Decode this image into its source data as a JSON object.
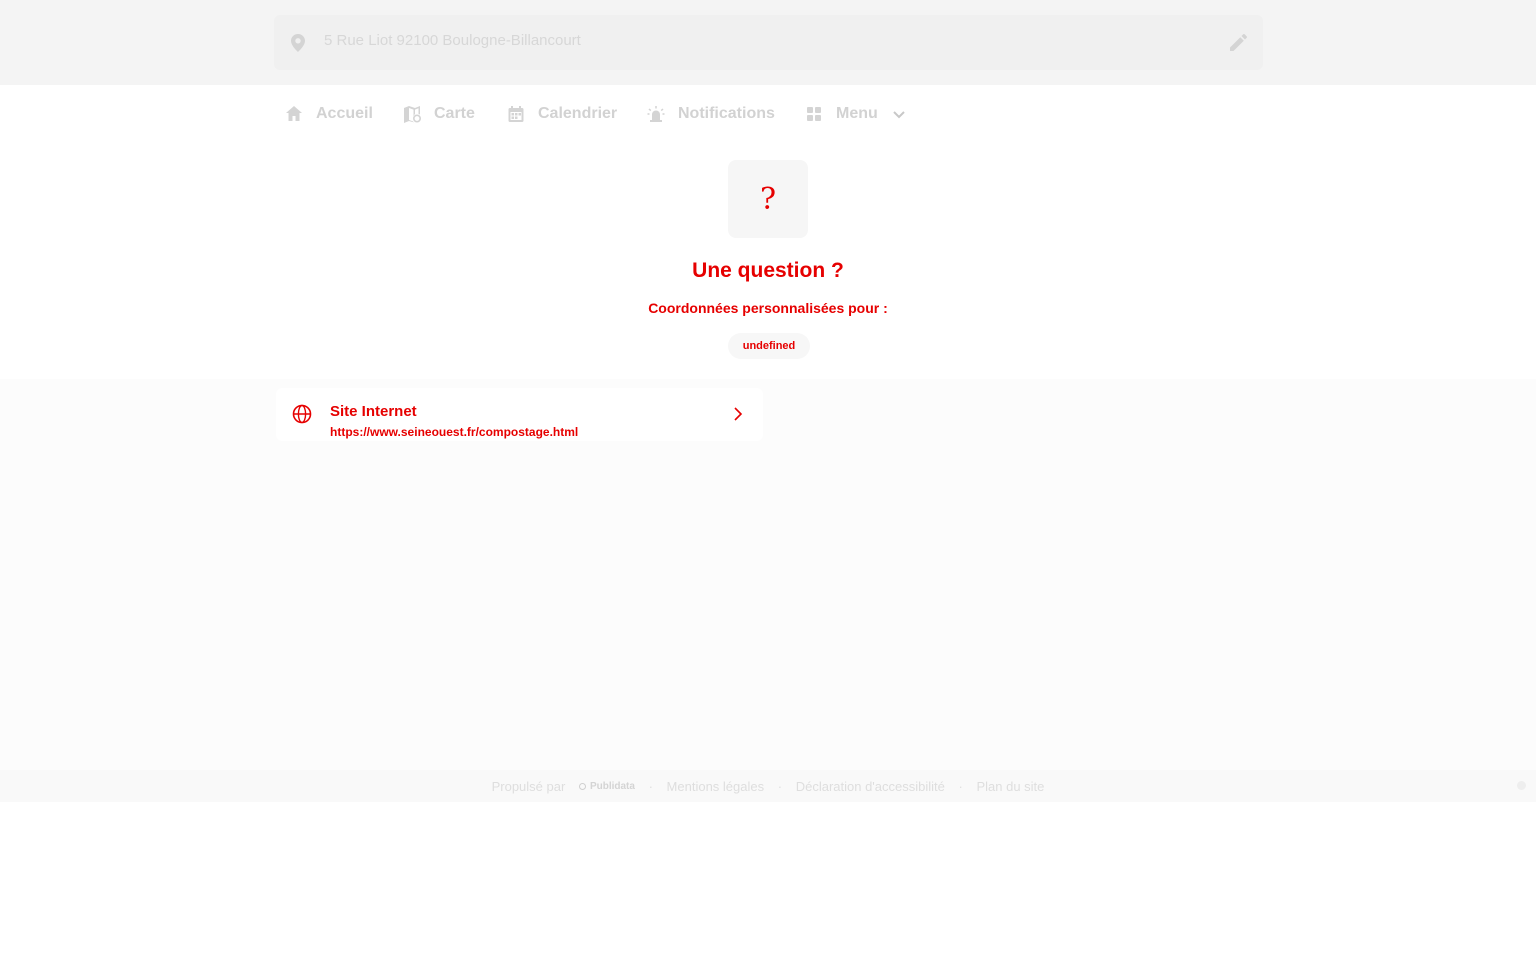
{
  "address": {
    "text": "5 Rue Liot 92100 Boulogne-Billancourt",
    "pin_icon": "location-pin-icon",
    "edit_icon": "pencil-icon"
  },
  "nav": {
    "items": [
      {
        "label": "Accueil",
        "icon": "home-icon"
      },
      {
        "label": "Carte",
        "icon": "map-icon"
      },
      {
        "label": "Calendrier",
        "icon": "calendar-icon"
      },
      {
        "label": "Notifications",
        "icon": "alarm-bell-icon"
      },
      {
        "label": "Menu",
        "icon": "grid-icon"
      }
    ]
  },
  "hero": {
    "icon_glyph": "?",
    "title": "Une question ?",
    "subtitle": "Coordonnées personnalisées pour :",
    "pill": "undefined"
  },
  "card": {
    "title": "Site Internet",
    "url": "https://www.seineouest.fr/compostage.html",
    "icon": "globe-icon",
    "arrow_icon": "chevron-right-icon"
  },
  "footer": {
    "powered_by": "Propulsé par",
    "brand": "Publidata",
    "separator": "·",
    "links": [
      "Mentions légales",
      "Déclaration d'accessibilité",
      "Plan du site"
    ]
  },
  "colors": {
    "accent": "#e60000",
    "muted_text": "#d2d2d2",
    "band_bg": "#f4f4f4"
  }
}
